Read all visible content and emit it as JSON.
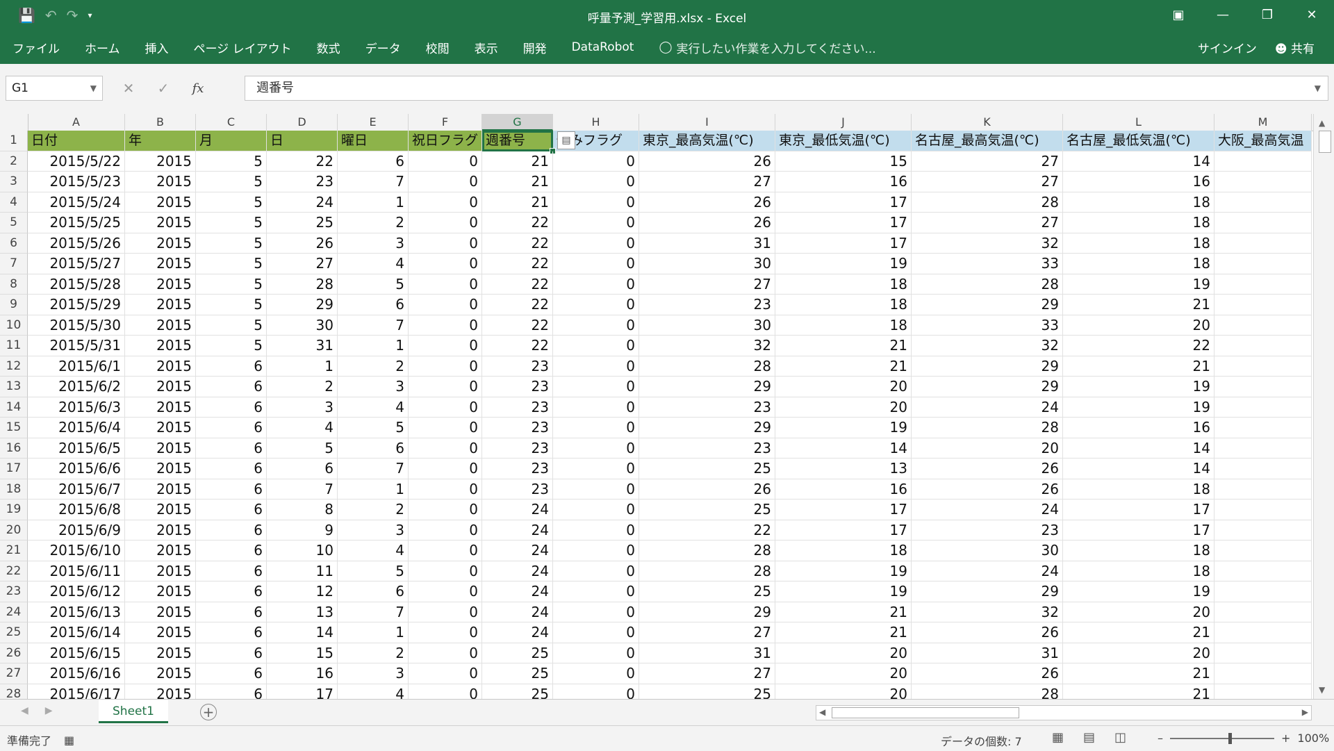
{
  "window": {
    "title": "呼量予測_学習用.xlsx - Excel",
    "icons": [
      "save-icon",
      "undo-icon",
      "redo-icon",
      "customize-qat-icon",
      "ribbon-display-icon",
      "minimize-icon",
      "restore-icon",
      "close-icon"
    ]
  },
  "menu": {
    "tabs": [
      "ファイル",
      "ホーム",
      "挿入",
      "ページ レイアウト",
      "数式",
      "データ",
      "校閲",
      "表示",
      "開発",
      "DataRobot"
    ],
    "tell_me": "実行したい作業を入力してください...",
    "signin": "サインイン",
    "share": "共有"
  },
  "formula_bar": {
    "name_box": "G1",
    "fx_label": "fx",
    "content": "週番号"
  },
  "columns": [
    "A",
    "B",
    "C",
    "D",
    "E",
    "F",
    "G",
    "H",
    "I",
    "J",
    "K",
    "L",
    "M"
  ],
  "selected_column": "G",
  "header_row": [
    "日付",
    "年",
    "月",
    "日",
    "曜日",
    "祝日フラグ",
    "週番号",
    "休みフラグ",
    "東京_最高気温(℃)",
    "東京_最低気温(℃)",
    "名古屋_最高気温(℃)",
    "名古屋_最低気温(℃)",
    "大阪_最高気温"
  ],
  "rows": [
    [
      "2015/5/22",
      "2015",
      "5",
      "22",
      "6",
      "0",
      "21",
      "0",
      "26",
      "15",
      "27",
      "14"
    ],
    [
      "2015/5/23",
      "2015",
      "5",
      "23",
      "7",
      "0",
      "21",
      "0",
      "27",
      "16",
      "27",
      "16"
    ],
    [
      "2015/5/24",
      "2015",
      "5",
      "24",
      "1",
      "0",
      "21",
      "0",
      "26",
      "17",
      "28",
      "18"
    ],
    [
      "2015/5/25",
      "2015",
      "5",
      "25",
      "2",
      "0",
      "22",
      "0",
      "26",
      "17",
      "27",
      "18"
    ],
    [
      "2015/5/26",
      "2015",
      "5",
      "26",
      "3",
      "0",
      "22",
      "0",
      "31",
      "17",
      "32",
      "18"
    ],
    [
      "2015/5/27",
      "2015",
      "5",
      "27",
      "4",
      "0",
      "22",
      "0",
      "30",
      "19",
      "33",
      "18"
    ],
    [
      "2015/5/28",
      "2015",
      "5",
      "28",
      "5",
      "0",
      "22",
      "0",
      "27",
      "18",
      "28",
      "19"
    ],
    [
      "2015/5/29",
      "2015",
      "5",
      "29",
      "6",
      "0",
      "22",
      "0",
      "23",
      "18",
      "29",
      "21"
    ],
    [
      "2015/5/30",
      "2015",
      "5",
      "30",
      "7",
      "0",
      "22",
      "0",
      "30",
      "18",
      "33",
      "20"
    ],
    [
      "2015/5/31",
      "2015",
      "5",
      "31",
      "1",
      "0",
      "22",
      "0",
      "32",
      "21",
      "32",
      "22"
    ],
    [
      "2015/6/1",
      "2015",
      "6",
      "1",
      "2",
      "0",
      "23",
      "0",
      "28",
      "21",
      "29",
      "21"
    ],
    [
      "2015/6/2",
      "2015",
      "6",
      "2",
      "3",
      "0",
      "23",
      "0",
      "29",
      "20",
      "29",
      "19"
    ],
    [
      "2015/6/3",
      "2015",
      "6",
      "3",
      "4",
      "0",
      "23",
      "0",
      "23",
      "20",
      "24",
      "19"
    ],
    [
      "2015/6/4",
      "2015",
      "6",
      "4",
      "5",
      "0",
      "23",
      "0",
      "29",
      "19",
      "28",
      "16"
    ],
    [
      "2015/6/5",
      "2015",
      "6",
      "5",
      "6",
      "0",
      "23",
      "0",
      "23",
      "14",
      "20",
      "14"
    ],
    [
      "2015/6/6",
      "2015",
      "6",
      "6",
      "7",
      "0",
      "23",
      "0",
      "25",
      "13",
      "26",
      "14"
    ],
    [
      "2015/6/7",
      "2015",
      "6",
      "7",
      "1",
      "0",
      "23",
      "0",
      "26",
      "16",
      "26",
      "18"
    ],
    [
      "2015/6/8",
      "2015",
      "6",
      "8",
      "2",
      "0",
      "24",
      "0",
      "25",
      "17",
      "24",
      "17"
    ],
    [
      "2015/6/9",
      "2015",
      "6",
      "9",
      "3",
      "0",
      "24",
      "0",
      "22",
      "17",
      "23",
      "17"
    ],
    [
      "2015/6/10",
      "2015",
      "6",
      "10",
      "4",
      "0",
      "24",
      "0",
      "28",
      "18",
      "30",
      "18"
    ],
    [
      "2015/6/11",
      "2015",
      "6",
      "11",
      "5",
      "0",
      "24",
      "0",
      "28",
      "19",
      "24",
      "18"
    ],
    [
      "2015/6/12",
      "2015",
      "6",
      "12",
      "6",
      "0",
      "24",
      "0",
      "25",
      "19",
      "29",
      "19"
    ],
    [
      "2015/6/13",
      "2015",
      "6",
      "13",
      "7",
      "0",
      "24",
      "0",
      "29",
      "21",
      "32",
      "20"
    ],
    [
      "2015/6/14",
      "2015",
      "6",
      "14",
      "1",
      "0",
      "24",
      "0",
      "27",
      "21",
      "26",
      "21"
    ],
    [
      "2015/6/15",
      "2015",
      "6",
      "15",
      "2",
      "0",
      "25",
      "0",
      "31",
      "20",
      "31",
      "20"
    ],
    [
      "2015/6/16",
      "2015",
      "6",
      "16",
      "3",
      "0",
      "25",
      "0",
      "27",
      "20",
      "26",
      "21"
    ],
    [
      "2015/6/17",
      "2015",
      "6",
      "17",
      "4",
      "0",
      "25",
      "0",
      "25",
      "20",
      "28",
      "21"
    ]
  ],
  "sheet_tabs": [
    "Sheet1"
  ],
  "status": {
    "ready": "準備完了",
    "count": "データの個数: 7",
    "zoom": "100%"
  },
  "colors": {
    "accent": "#217346",
    "header_green": "#8db34a",
    "header_blue": "#c2dded"
  }
}
